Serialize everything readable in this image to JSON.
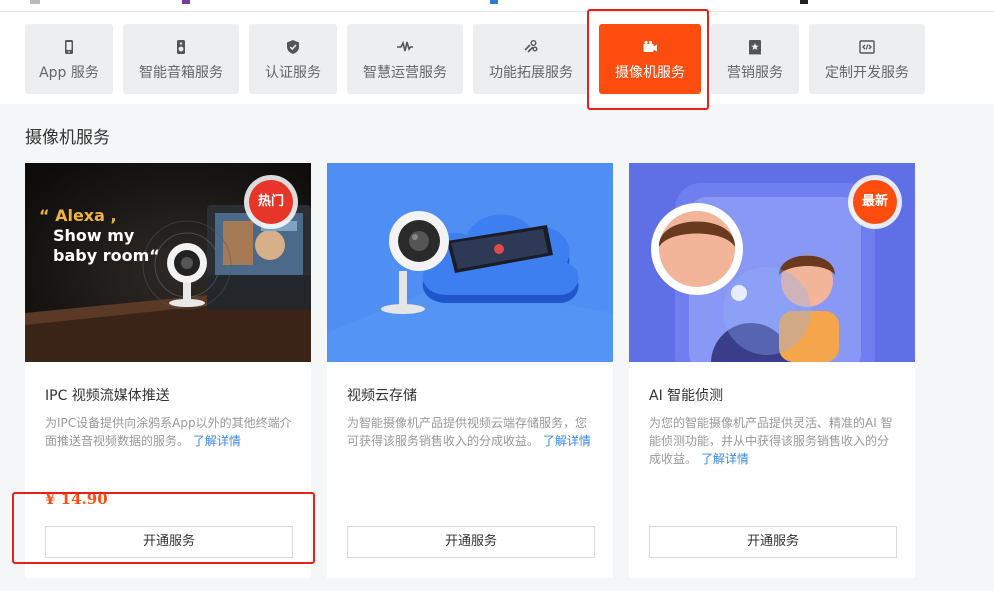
{
  "tabs": [
    {
      "label": "App 服务",
      "icon": "phone-icon"
    },
    {
      "label": "智能音箱服务",
      "icon": "speaker-icon"
    },
    {
      "label": "认证服务",
      "icon": "shield-icon"
    },
    {
      "label": "智慧运营服务",
      "icon": "pulse-icon"
    },
    {
      "label": "功能拓展服务",
      "icon": "puzzle-icon"
    },
    {
      "label": "摄像机服务",
      "icon": "camera-icon",
      "active": true
    },
    {
      "label": "营销服务",
      "icon": "star-badge-icon"
    },
    {
      "label": "定制开发服务",
      "icon": "code-icon"
    }
  ],
  "section": {
    "title": "摄像机服务"
  },
  "cards": [
    {
      "title": "IPC 视频流媒体推送",
      "desc": "为IPC设备提供向涂鸦系App以外的其他终端介面推送音视频数据的服务。",
      "more": "了解详情",
      "price": "¥ 14.90",
      "button": "开通服务",
      "badge": "热门",
      "image_text": [
        "“ Alexa ,",
        "Show my",
        "baby room“"
      ]
    },
    {
      "title": "视频云存储",
      "desc": "为智能摄像机产品提供视频云端存储服务，您可获得该服务销售收入的分成收益。",
      "more": "了解详情",
      "button": "开通服务"
    },
    {
      "title": "AI 智能侦测",
      "desc": "为您的智能摄像机产品提供灵活、精准的AI 智能侦测功能，并从中获得该服务销售收入的分成收益。",
      "more": "了解详情",
      "button": "开通服务",
      "badge": "最新"
    }
  ],
  "colors": {
    "accent": "#ff4c0f",
    "highlight": "#e8201a",
    "link": "#3c8ae0"
  }
}
